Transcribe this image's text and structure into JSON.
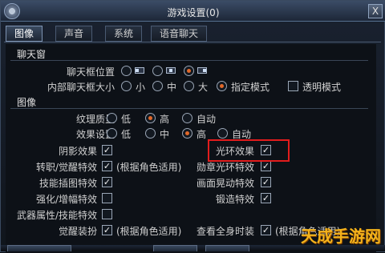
{
  "window": {
    "title": "游戏设置(0)",
    "close_label": "X"
  },
  "tabs": [
    {
      "label": "图像",
      "active": true
    },
    {
      "label": "声音",
      "active": false
    },
    {
      "label": "系统",
      "active": false
    },
    {
      "label": "语音聊天",
      "active": false
    }
  ],
  "chat_section": {
    "title": "聊天窗",
    "position_label": "聊天框位置",
    "inner_size_label": "内部聊天框大小",
    "size_options": [
      "小",
      "中",
      "大"
    ],
    "specify_mode_label": "指定模式",
    "transparent_mode_label": "透明模式"
  },
  "image_section": {
    "title": "图像",
    "texture_label": "纹理质量",
    "effect_label": "效果设置",
    "levels": [
      "低",
      "高",
      "自动"
    ],
    "effect_levels": [
      "低",
      "中",
      "高",
      "自动"
    ]
  },
  "effects": {
    "shadow": "阴影效果",
    "halo": "光环效果",
    "awaken": "转职/觉醒特效",
    "awaken_sub": "(根据角色适用)",
    "medal": "勋章光环特效",
    "skill_illust": "技能插图特效",
    "screen_shake": "画面晃动特效",
    "enhance": "强化/增幅特效",
    "forge": "锻造特效",
    "weapon_attr": "武器属性/技能特效",
    "awaken_outfit": "觉醒装扮",
    "outfit_sub": "(根据角色适用)",
    "full_view": "查看全身时装",
    "full_view_sub": "(根据角色适用)"
  },
  "watermark": "天成手游网"
}
